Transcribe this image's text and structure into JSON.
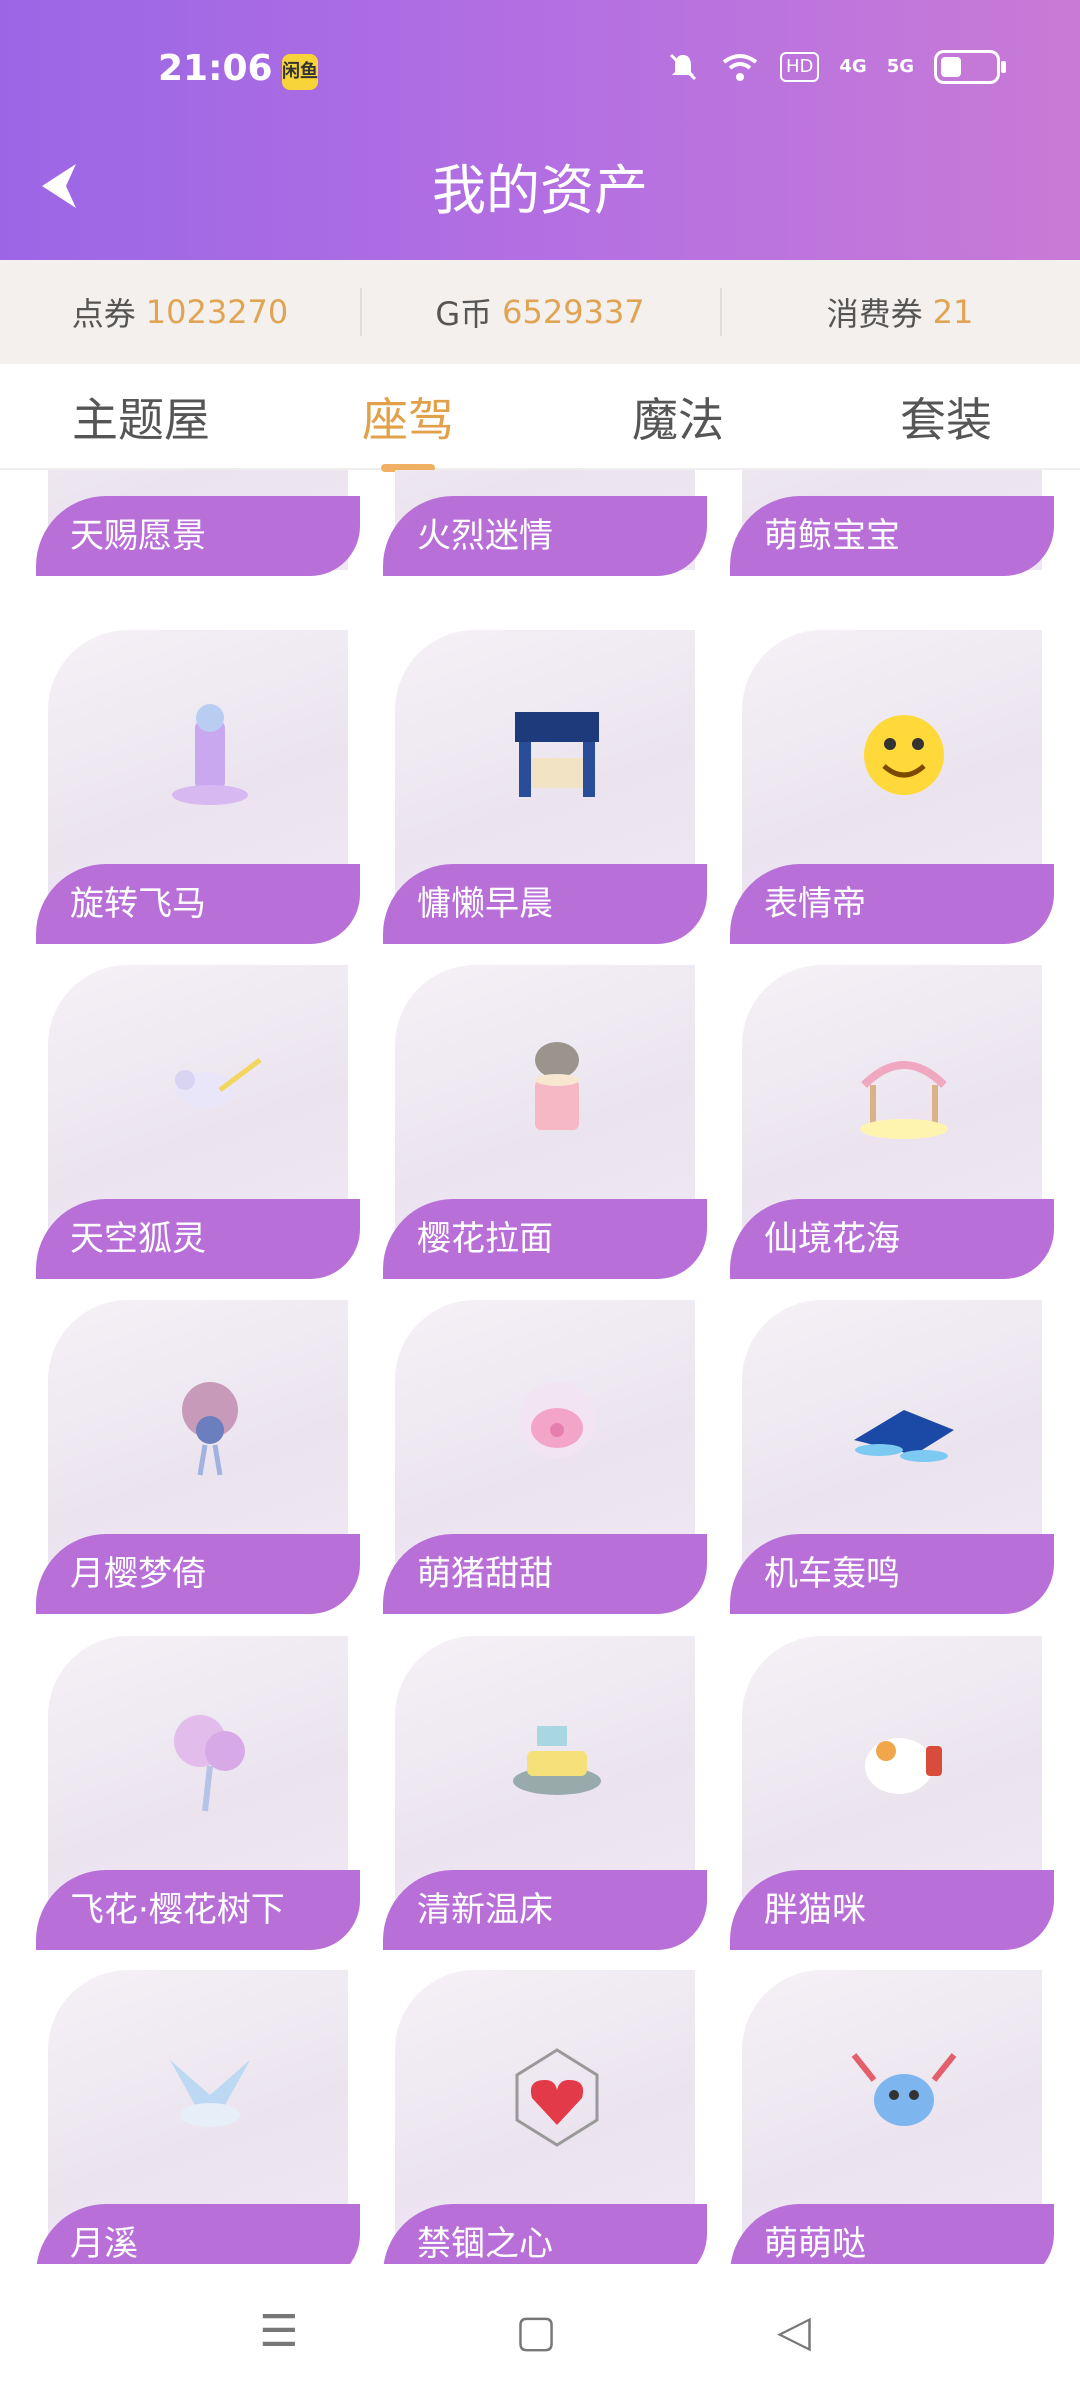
{
  "status_bar": {
    "time": "21:06",
    "app_badge": "闲鱼",
    "icons": [
      "silent-icon",
      "wifi-icon",
      "hd-icon",
      "4g-signal-icon",
      "5g-signal-icon",
      "battery-icon"
    ],
    "hd_label": "HD",
    "sig4g": "4G",
    "sig5g": "5G"
  },
  "header": {
    "title": "我的资产",
    "back_icon": "back-arrow-icon"
  },
  "assets": [
    {
      "label": "点券",
      "value": "1023270"
    },
    {
      "label": "G币",
      "value": "6529337"
    },
    {
      "label": "消费券",
      "value": "21"
    }
  ],
  "tabs": [
    {
      "label": "主题屋",
      "active": false
    },
    {
      "label": "座驾",
      "active": true
    },
    {
      "label": "魔法",
      "active": false
    },
    {
      "label": "套装",
      "active": false
    }
  ],
  "items": [
    {
      "name": "天赐愿景"
    },
    {
      "name": "火烈迷情"
    },
    {
      "name": "萌鲸宝宝"
    },
    {
      "name": "旋转飞马"
    },
    {
      "name": "慵懒早晨"
    },
    {
      "name": "表情帝"
    },
    {
      "name": "天空狐灵"
    },
    {
      "name": "樱花拉面"
    },
    {
      "name": "仙境花海"
    },
    {
      "name": "月樱梦倚"
    },
    {
      "name": "萌猪甜甜"
    },
    {
      "name": "机车轰鸣"
    },
    {
      "name": "飞花·樱花树下"
    },
    {
      "name": "清新温床"
    },
    {
      "name": "胖猫咪"
    },
    {
      "name": "月溪"
    },
    {
      "name": "禁锢之心"
    },
    {
      "name": "萌萌哒"
    }
  ],
  "nav": {
    "menu_icon": "menu-icon",
    "home_icon": "home-square-icon",
    "back_icon": "back-triangle-icon",
    "menu_glyph": "☰",
    "home_glyph": "▢",
    "back_glyph": "◁"
  },
  "colors": {
    "header_gradient_start": "#9b66e6",
    "header_gradient_end": "#c87ad6",
    "label_purple": "#b96fd8",
    "accent_gold": "#e1a14a",
    "asset_value": "#e0a454"
  }
}
